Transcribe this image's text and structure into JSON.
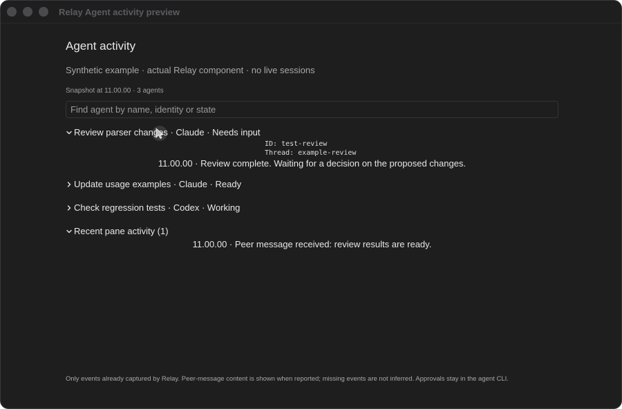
{
  "window": {
    "title": "Relay Agent activity preview"
  },
  "page": {
    "heading": "Agent activity",
    "subtitle": "Synthetic example · actual Relay component · no live sessions",
    "snapshot": "Snapshot at 11.00.00 · 3 agents"
  },
  "search": {
    "placeholder": "Find agent by name, identity or state",
    "value": ""
  },
  "agents": [
    {
      "label": "Review parser changes · Claude · Needs input",
      "expanded": true,
      "id_line": "ID: test-review",
      "thread_line": "Thread: example-review",
      "event": "11.00.00 · Review complete. Waiting for a decision on the proposed changes."
    },
    {
      "label": "Update usage examples · Claude · Ready",
      "expanded": false
    },
    {
      "label": "Check regression tests · Codex · Working",
      "expanded": false
    }
  ],
  "recent": {
    "label": "Recent pane activity (1)",
    "expanded": true,
    "event": "11.00.00 · Peer message received: review results are ready."
  },
  "footer": {
    "note": "Only events already captured by Relay. Peer-message content is shown when reported; missing events are not inferred. Approvals stay in the agent CLI."
  },
  "colors": {
    "background": "#1e1e1f",
    "text": "#e6e6e6",
    "muted": "#a8a8a8"
  }
}
